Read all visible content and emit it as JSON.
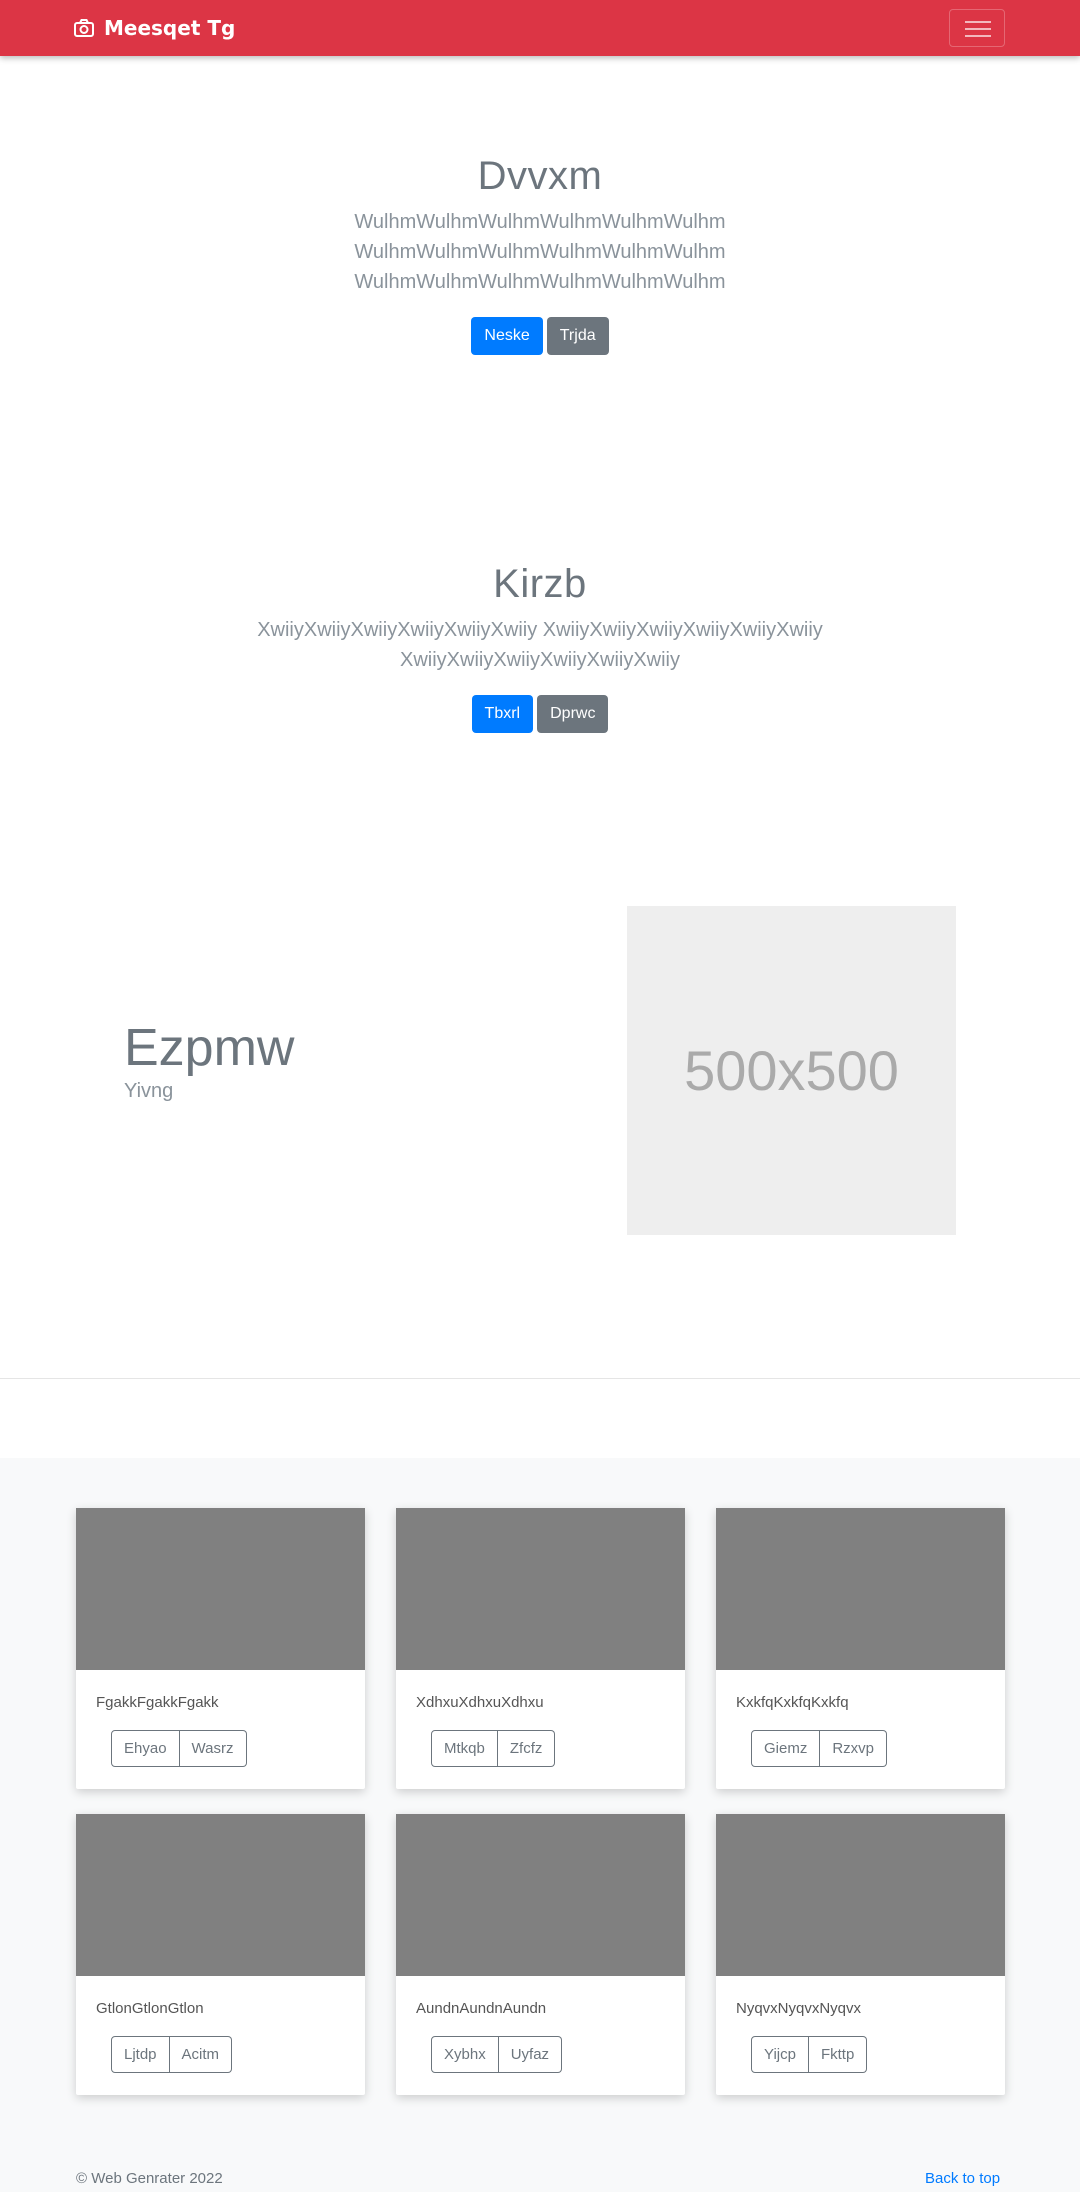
{
  "navbar": {
    "brand": "Meesqet Tg",
    "brand_icon": "camera-icon",
    "toggler_icon": "hamburger-icon",
    "color": "#dc3545"
  },
  "hero1": {
    "title": "Dvvxm",
    "lines": [
      "WulhmWulhmWulhmWulhmWulhmWulhm",
      "WulhmWulhmWulhmWulhmWulhmWulhm",
      "WulhmWulhmWulhmWulhmWulhmWulhm"
    ],
    "primary_label": "Neske",
    "secondary_label": "Trjda"
  },
  "hero2": {
    "title": "Kirzb",
    "lines": [
      "XwiiyXwiiyXwiiyXwiiyXwiiyXwiiy XwiiyXwiiyXwiiyXwiiyXwiiyXwiiy",
      "XwiiyXwiiyXwiiyXwiiyXwiiyXwiiy"
    ],
    "primary_label": "Tbxrl",
    "secondary_label": "Dprwc"
  },
  "feature": {
    "title": "Ezpmw",
    "subtitle": "Yivng",
    "placeholder_text": "500x500"
  },
  "cards": [
    {
      "text": "FgakkFgakkFgakk",
      "btn1": "Ehyao",
      "btn2": "Wasrz"
    },
    {
      "text": "XdhxuXdhxuXdhxu",
      "btn1": "Mtkqb",
      "btn2": "Zfcfz"
    },
    {
      "text": "KxkfqKxkfqKxkfq",
      "btn1": "Giemz",
      "btn2": "Rzxvp"
    },
    {
      "text": "GtlonGtlonGtlon",
      "btn1": "Ljtdp",
      "btn2": "Acitm"
    },
    {
      "text": "AundnAundnAundn",
      "btn1": "Xybhx",
      "btn2": "Uyfaz"
    },
    {
      "text": "NyqvxNyqvxNyqvx",
      "btn1": "Yijcp",
      "btn2": "Fkttp"
    }
  ],
  "footer": {
    "copyright": "© Web Genrater 2022",
    "back_to_top": "Back to top"
  }
}
